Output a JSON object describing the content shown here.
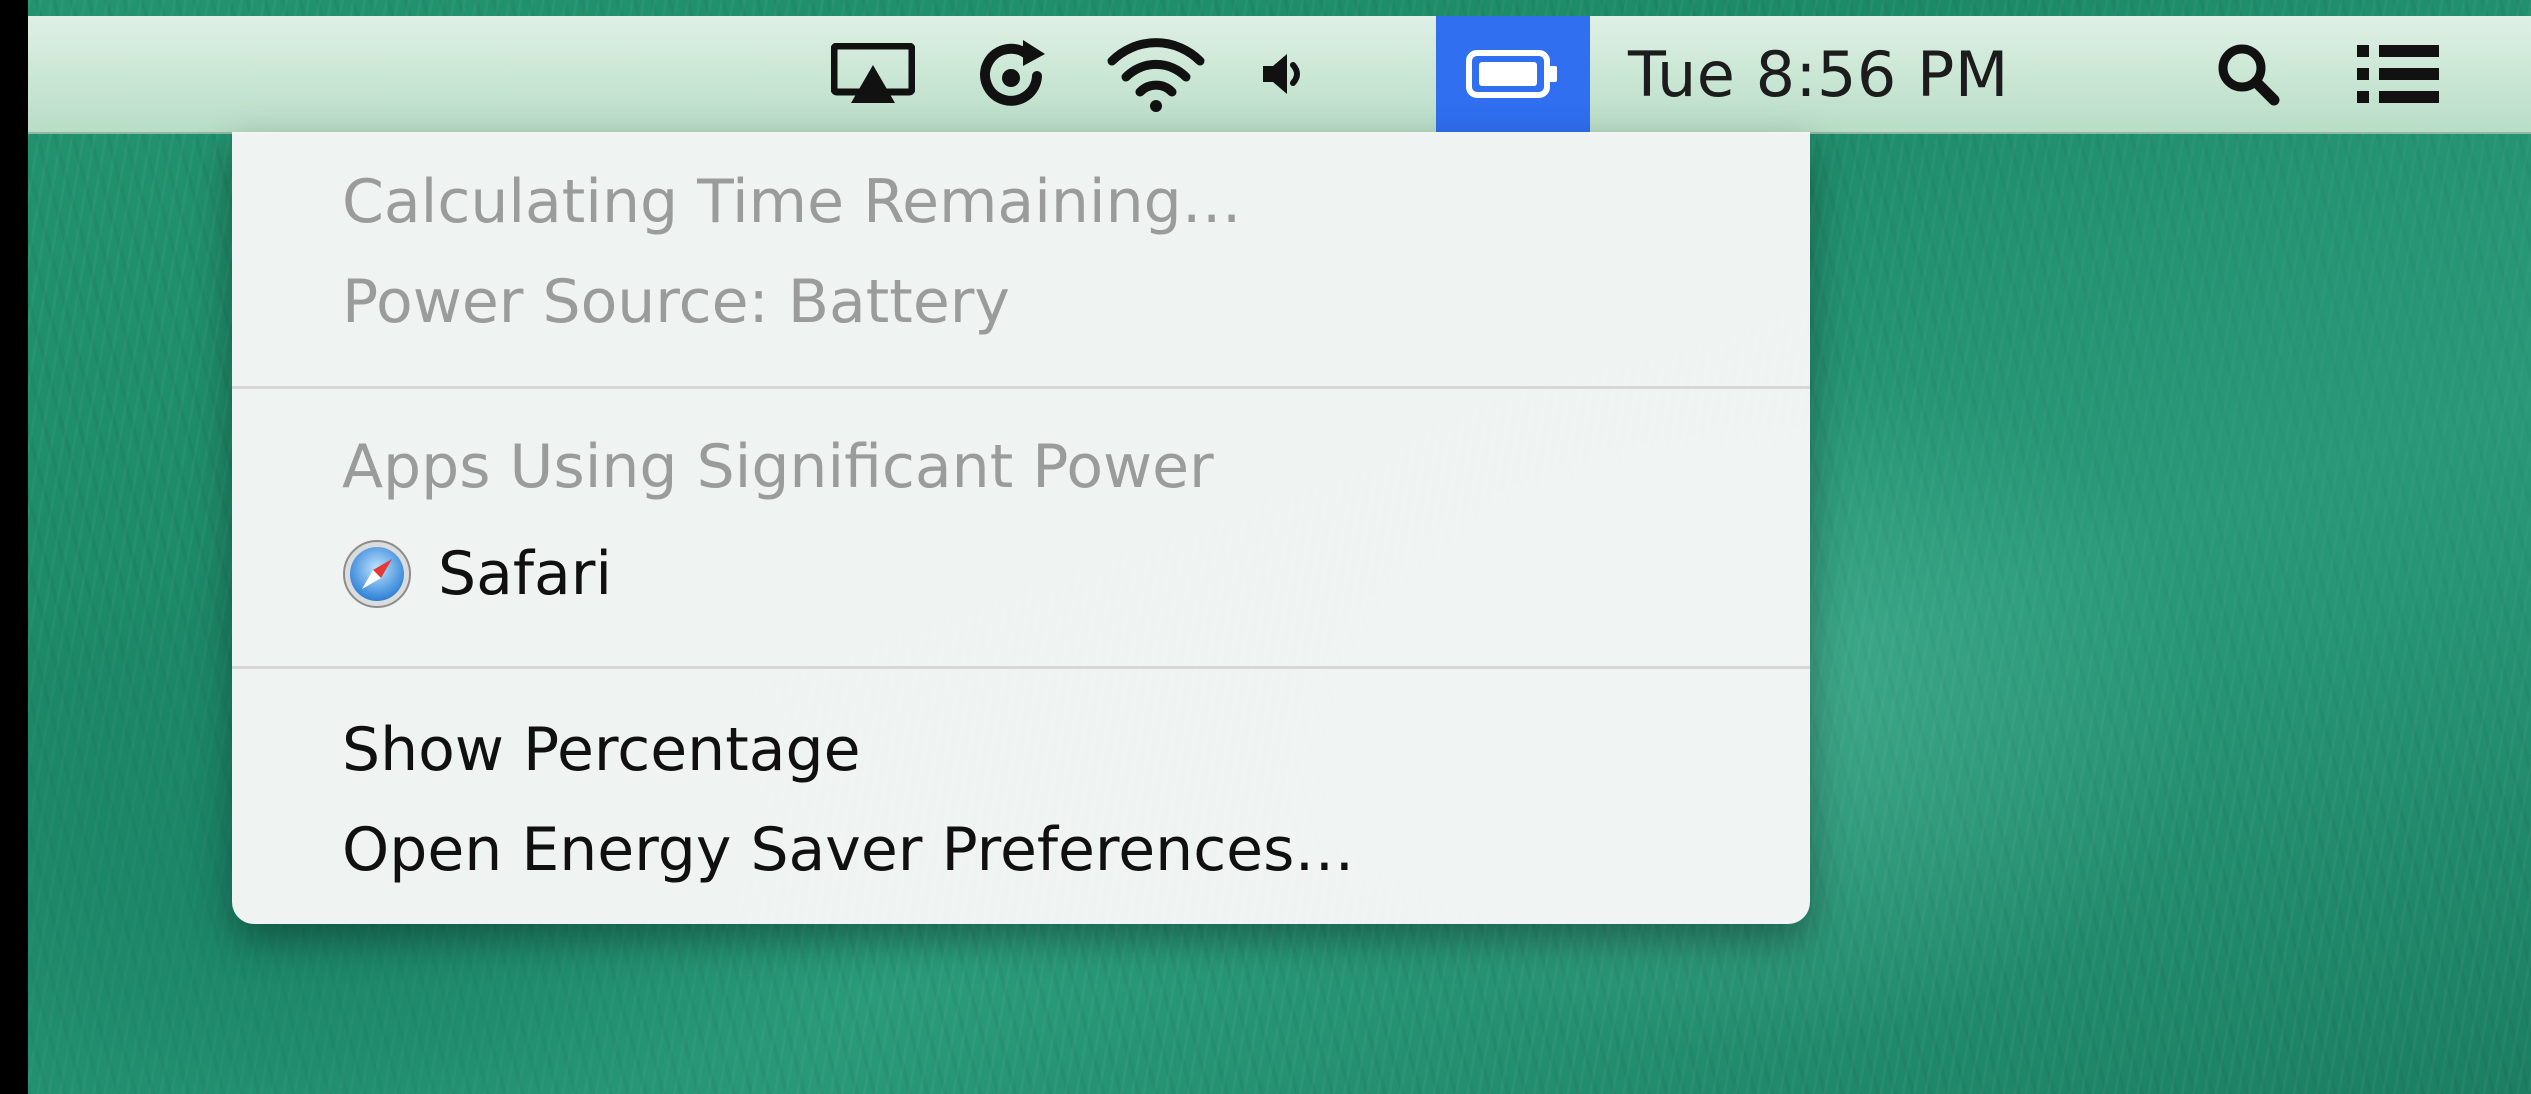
{
  "menubar": {
    "icons": {
      "airplay": "airplay-icon",
      "sync": "time-machine-icon",
      "wifi": "wifi-icon",
      "volume": "volume-icon",
      "battery": "battery-icon",
      "search": "spotlight-search-icon",
      "notifications": "notification-center-icon"
    },
    "clock": "Tue 8:56 PM",
    "highlight_color": "#2f6ff0"
  },
  "battery_menu": {
    "time_remaining": "Calculating Time Remaining…",
    "power_source": "Power Source: Battery",
    "apps_header": "Apps Using Significant Power",
    "apps": [
      {
        "name": "Safari",
        "icon": "safari-icon"
      }
    ],
    "show_percentage": "Show Percentage",
    "open_prefs": "Open Energy Saver Preferences…"
  }
}
